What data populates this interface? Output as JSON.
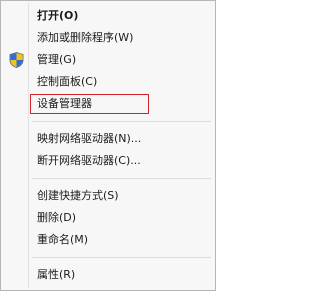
{
  "context_menu": {
    "items": [
      {
        "label": "打开(O)",
        "bold": true
      },
      {
        "label": "添加或删除程序(W)"
      },
      {
        "label": "管理(G)",
        "icon": "uac-shield-icon"
      },
      {
        "label": "控制面板(C)"
      },
      {
        "label": "设备管理器",
        "highlighted": true
      },
      {
        "label": "映射网络驱动器(N)..."
      },
      {
        "label": "断开网络驱动器(C)..."
      },
      {
        "label": "创建快捷方式(S)"
      },
      {
        "label": "删除(D)"
      },
      {
        "label": "重命名(M)"
      },
      {
        "label": "属性(R)"
      }
    ],
    "highlight_color": "#d8222a"
  }
}
